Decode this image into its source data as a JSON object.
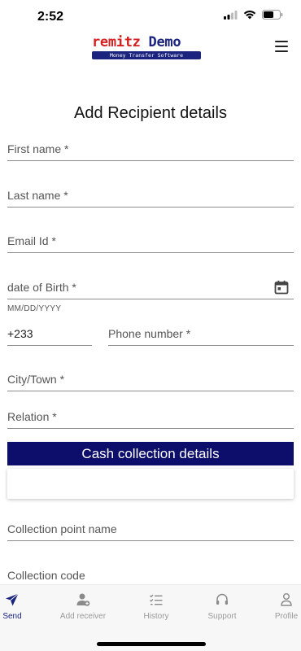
{
  "status_bar": {
    "time": "2:52"
  },
  "header": {
    "logo_brand_first": "remitz",
    "logo_brand_second": "Demo",
    "logo_tagline": "Money Transfer Software"
  },
  "page": {
    "title": "Add Recipient details"
  },
  "form": {
    "first_name": "First name *",
    "last_name": "Last name *",
    "email": "Email Id *",
    "dob": "date of Birth *",
    "dob_hint": "MM/DD/YYYY",
    "country_code": "+233",
    "phone": "Phone number *",
    "city": "City/Town *",
    "relation": "Relation *"
  },
  "cash_collection": {
    "section_label": "Cash collection details",
    "selected_value": "",
    "collection_point_name": "Collection point name",
    "collection_code": "Collection code"
  },
  "bottom_nav": {
    "items": [
      {
        "label": "Send",
        "icon": "send-icon"
      },
      {
        "label": "Add receiver",
        "icon": "add-user-icon"
      },
      {
        "label": "History",
        "icon": "history-list-icon"
      },
      {
        "label": "Support",
        "icon": "headset-icon"
      },
      {
        "label": "Profile",
        "icon": "person-icon"
      }
    ],
    "active_index": 0
  },
  "colors": {
    "brand_red": "#d42020",
    "brand_navy": "#1a237e",
    "section_bg": "#0d0d6b"
  }
}
